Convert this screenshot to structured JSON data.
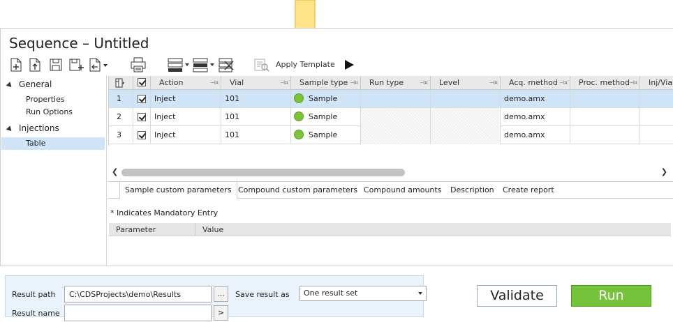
{
  "window": {
    "title": "Sequence – Untitled"
  },
  "toolbar": {
    "apply_template_label": "Apply Template"
  },
  "nav": {
    "groups": [
      {
        "label": "General",
        "items": [
          {
            "label": "Properties"
          },
          {
            "label": "Run Options"
          }
        ]
      },
      {
        "label": "Injections",
        "items": [
          {
            "label": "Table"
          }
        ]
      }
    ],
    "selected": "Table"
  },
  "grid": {
    "columns": [
      "Action",
      "Vial",
      "Sample type",
      "Run type",
      "Level",
      "Acq. method",
      "Proc. method",
      "Inj/Via"
    ],
    "rows": [
      {
        "num": "1",
        "checked": true,
        "action": "Inject",
        "vial": "101",
        "sample_type": "Sample",
        "run_type": "",
        "level": "",
        "acq_method": "demo.amx",
        "proc_method": ""
      },
      {
        "num": "2",
        "checked": true,
        "action": "Inject",
        "vial": "101",
        "sample_type": "Sample",
        "run_type": "",
        "level": "",
        "acq_method": "demo.amx",
        "proc_method": ""
      },
      {
        "num": "3",
        "checked": true,
        "action": "Inject",
        "vial": "101",
        "sample_type": "Sample",
        "run_type": "",
        "level": "",
        "acq_method": "demo.amx",
        "proc_method": ""
      }
    ],
    "selected_row": 1,
    "sample_dot_color": "#7cc33a"
  },
  "tabs": [
    {
      "label": "Sample custom parameters",
      "active": true
    },
    {
      "label": "Compound custom parameters"
    },
    {
      "label": "Compound amounts"
    },
    {
      "label": "Description"
    },
    {
      "label": "Create report"
    }
  ],
  "params": {
    "note": "* Indicates Mandatory Entry",
    "columns": [
      "Parameter",
      "Value"
    ]
  },
  "result": {
    "path_label": "Result path",
    "path_value": "C:\\CDSProjects\\demo\\Results",
    "browse_label": "...",
    "name_label": "Result name",
    "name_value": "",
    "name_button_label": ">",
    "save_label": "Save result as",
    "save_value": "One result set"
  },
  "actions": {
    "validate_label": "Validate",
    "run_label": "Run"
  },
  "colors": {
    "accent": "#74c33b",
    "selection": "#cfe5f7",
    "arrow": "#ffe07a"
  }
}
